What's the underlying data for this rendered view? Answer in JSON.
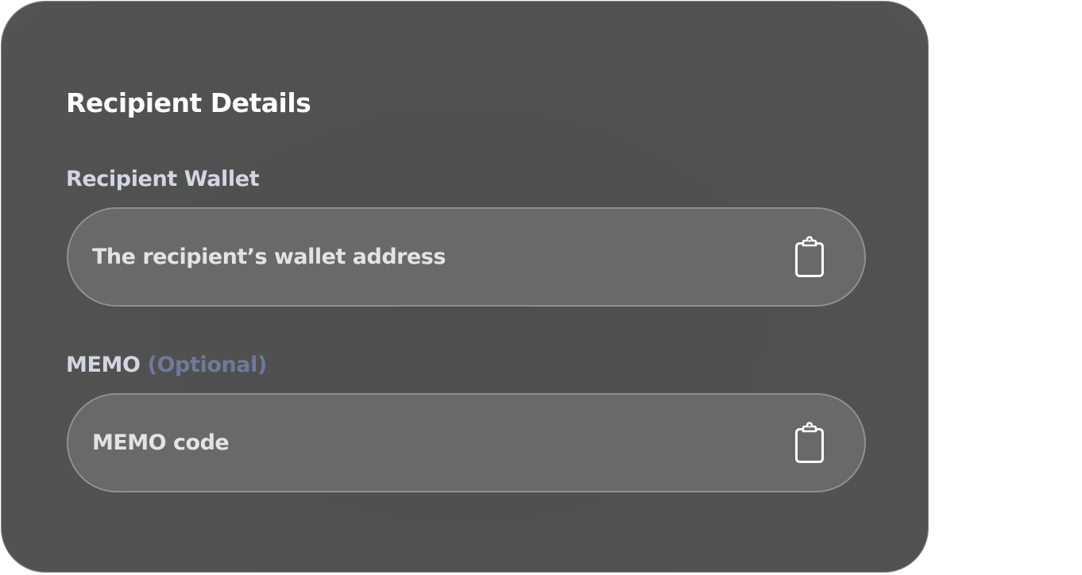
{
  "card": {
    "title": "Recipient Details"
  },
  "wallet": {
    "label": "Recipient Wallet",
    "value": "",
    "placeholder": "The recipient’s wallet address",
    "paste_icon": "clipboard-icon"
  },
  "memo": {
    "label": "MEMO",
    "optional_text": "(Optional)",
    "value": "",
    "placeholder": "MEMO code",
    "paste_icon": "clipboard-icon"
  },
  "colors": {
    "card_background": "#515151",
    "field_background": "#696969",
    "label": "#d3d6e2",
    "optional": "#6f7a98",
    "title": "#ffffff"
  }
}
